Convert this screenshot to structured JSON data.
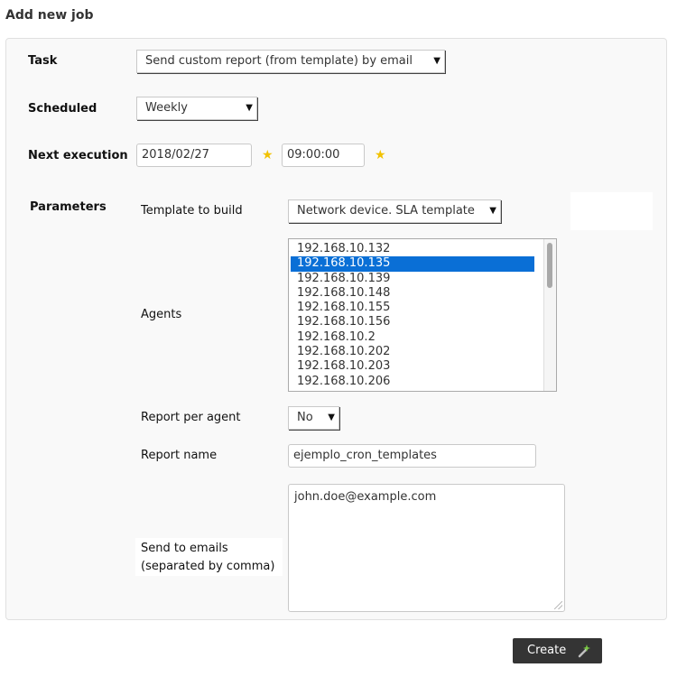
{
  "page": {
    "title": "Add new job"
  },
  "task": {
    "label": "Task",
    "value": "Send custom report (from template) by email"
  },
  "scheduled": {
    "label": "Scheduled",
    "value": "Weekly"
  },
  "next_execution": {
    "label": "Next execution",
    "date": "2018/02/27",
    "time": "09:00:00"
  },
  "parameters": {
    "label": "Parameters",
    "template": {
      "label": "Template to build",
      "value": "Network device. SLA template"
    },
    "agents": {
      "label": "Agents",
      "items": [
        "192.168.10.132",
        "192.168.10.135",
        "192.168.10.139",
        "192.168.10.148",
        "192.168.10.155",
        "192.168.10.156",
        "192.168.10.2",
        "192.168.10.202",
        "192.168.10.203",
        "192.168.10.206"
      ],
      "selected": "192.168.10.135"
    },
    "report_per_agent": {
      "label": "Report per agent",
      "value": "No"
    },
    "report_name": {
      "label": "Report name",
      "value": "ejemplo_cron_templates"
    },
    "emails": {
      "label_line1": "Send to emails",
      "label_line2": "(separated by comma)",
      "value": "john.doe@example.com"
    }
  },
  "actions": {
    "create_label": "Create"
  },
  "icons": {
    "required": "star-icon",
    "create": "wand-icon",
    "dropdown": "caret-down-icon"
  },
  "colors": {
    "selection": "#0a6fd6",
    "star": "#f2c200",
    "button": "#343434"
  }
}
